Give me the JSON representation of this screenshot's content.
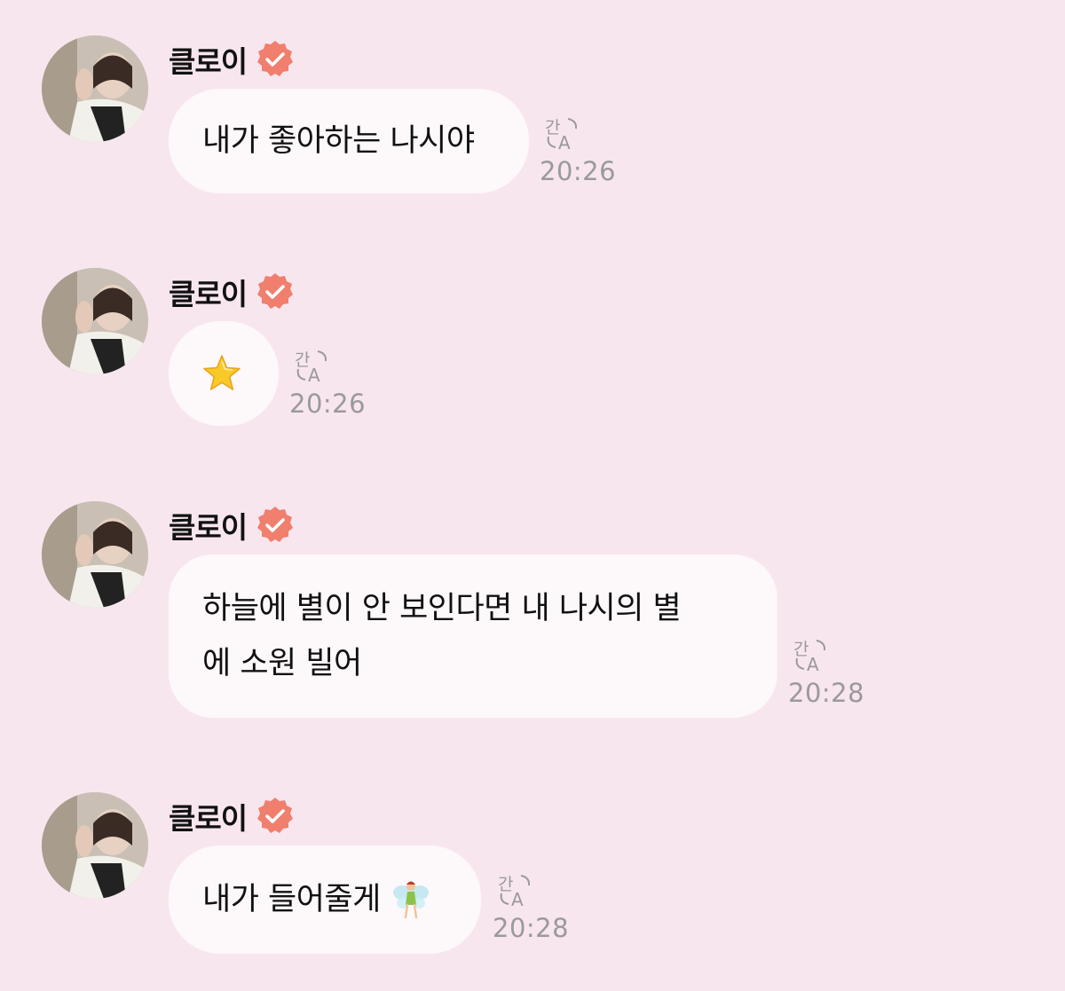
{
  "messages": [
    {
      "sender": "클로이",
      "text": "내가 좋아하는 나시야",
      "time": "20:26"
    },
    {
      "sender": "클로이",
      "emoji": "star",
      "time": "20:26"
    },
    {
      "sender": "클로이",
      "line1": "하늘에 별이 안 보인다면 내 나시의 별",
      "line2": "에 소원 빌어",
      "time": "20:28"
    },
    {
      "sender": "클로이",
      "text": "내가 들어줄게",
      "emoji": "fairy",
      "time": "20:28"
    }
  ],
  "colors": {
    "background": "#f8e6ef",
    "bubble": "#fdf8fa",
    "badge": "#f07f6e",
    "time": "#9a9a9a"
  },
  "icons": {
    "verified": "verified-badge-icon",
    "translate": "translate-icon"
  }
}
